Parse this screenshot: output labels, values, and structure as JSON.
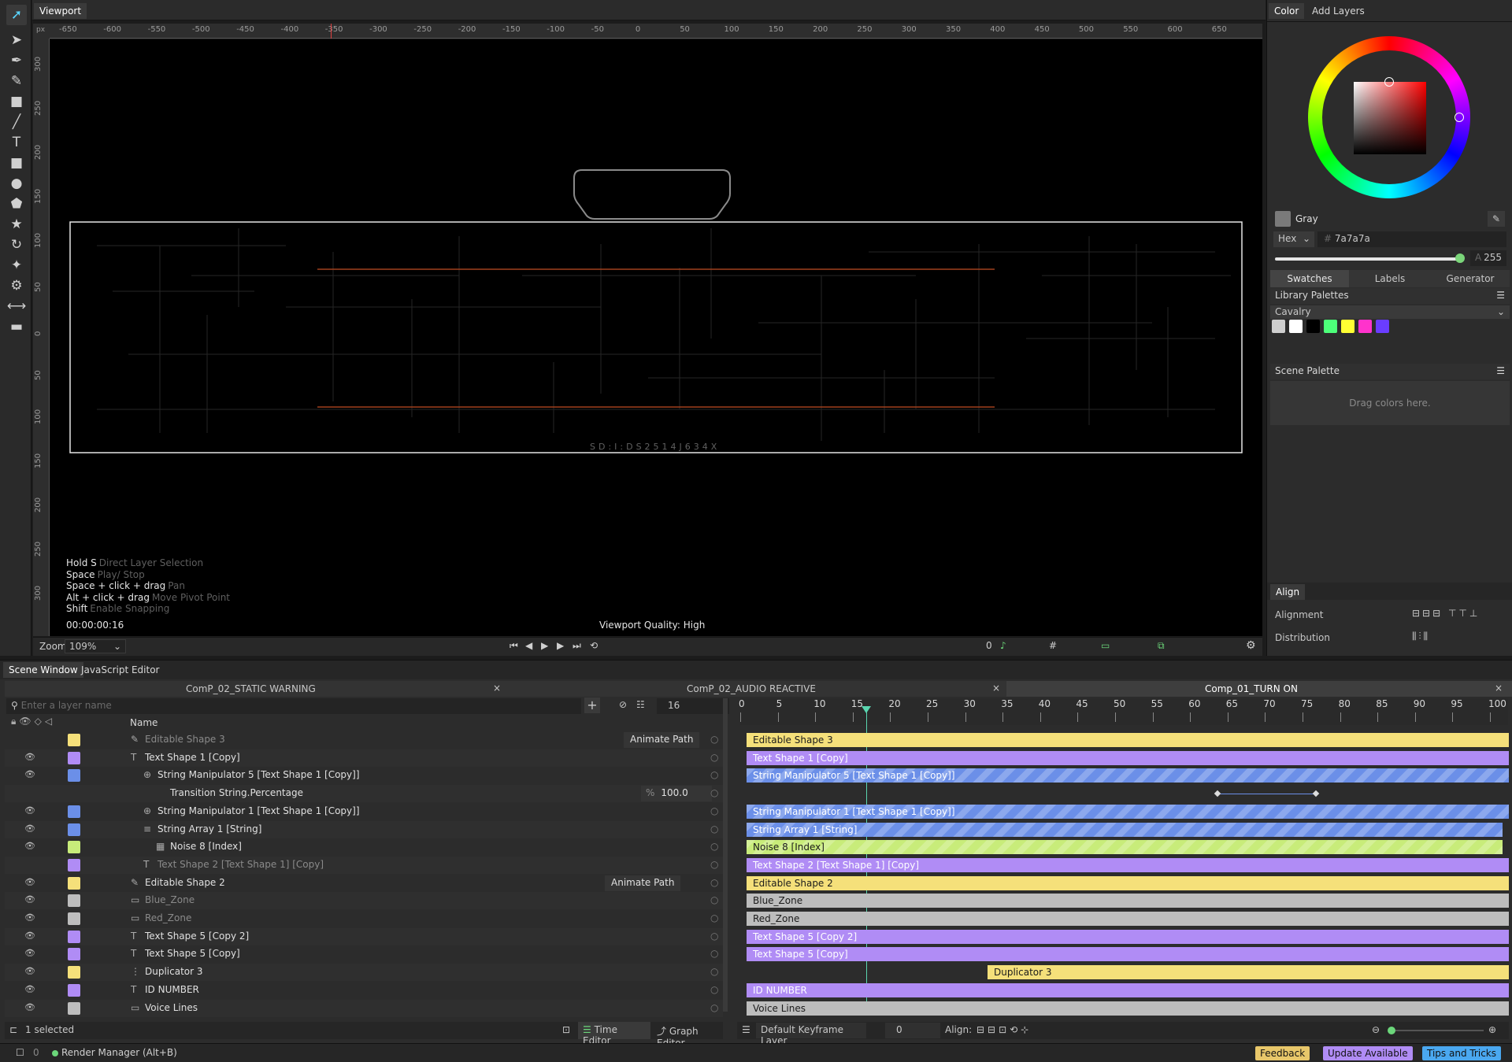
{
  "viewport": {
    "tab": "Viewport",
    "unit": "px",
    "ruler_h": [
      "-650",
      "-600",
      "-550",
      "-500",
      "-450",
      "-400",
      "-350",
      "-300",
      "-250",
      "-200",
      "-150",
      "-100",
      "-50",
      "0",
      "50",
      "100",
      "150",
      "200",
      "250",
      "300",
      "350",
      "400",
      "450",
      "500",
      "550",
      "600",
      "650"
    ],
    "ruler_v": [
      "300",
      "250",
      "200",
      "150",
      "100",
      "50",
      "0",
      "50",
      "100",
      "150",
      "200",
      "250",
      "300"
    ],
    "canvas_caption": "SD:I:DS2514J634X",
    "hints": [
      {
        "key": "Hold S",
        "desc": "Direct Layer Selection"
      },
      {
        "key": "Space",
        "desc": "Play/ Stop"
      },
      {
        "key": "Space + click + drag",
        "desc": "Pan"
      },
      {
        "key": "Alt + click + drag",
        "desc": "Move Pivot Point"
      },
      {
        "key": "Shift",
        "desc": "Enable Snapping"
      }
    ],
    "timecode": "00:00:00:16",
    "quality": "Viewport Quality: High",
    "zoom_label": "Zoom",
    "zoom_value": "109%",
    "frame_value": "0"
  },
  "color": {
    "tabs": [
      "Color",
      "Add Layers"
    ],
    "name": "Gray",
    "hex_label": "Hex",
    "hex": "7a7a7a",
    "alpha_label": "A",
    "alpha": "255",
    "subtabs": [
      "Swatches",
      "Labels",
      "Generator"
    ],
    "library_title": "Library Palettes",
    "palette_name": "Cavalry",
    "swatches": [
      "#cfcfcf",
      "#ffffff",
      "#000000",
      "#4dff7a",
      "#ffff33",
      "#ff33cc",
      "#6a3dff"
    ],
    "scene_palette": "Scene Palette",
    "drag_hint": "Drag colors here."
  },
  "align": {
    "title": "Align",
    "alignment": "Alignment",
    "distribution": "Distribution"
  },
  "scene": {
    "tabs": [
      "Scene Window",
      "JavaScript Editor"
    ],
    "comps": [
      "ComP_02_STATIC WARNING",
      "ComP_02_AUDIO REACTIVE",
      "Comp_01_TURN ON"
    ],
    "search_placeholder": "Enter a layer name",
    "frame": "16",
    "name_header": "Name",
    "animate_path": "Animate Path",
    "transition_value": "100.0",
    "pct": "%",
    "layers": [
      {
        "name": "Editable Shape 3",
        "color": "#f5e07a",
        "dim": true
      },
      {
        "name": "Text Shape 1 [Copy]",
        "color": "#b08cf5",
        "dim": false
      },
      {
        "name": "String Manipulator 5 [Text Shape 1 [Copy]]",
        "color": "#6b8fe8",
        "dim": false
      },
      {
        "name": "Transition String.Percentage",
        "color": "",
        "dim": false
      },
      {
        "name": "String Manipulator 1 [Text Shape 1 [Copy]]",
        "color": "#6b8fe8",
        "dim": false
      },
      {
        "name": "String Array 1 [String]",
        "color": "#6b8fe8",
        "dim": false
      },
      {
        "name": "Noise 8 [Index]",
        "color": "#c8ec7a",
        "dim": false
      },
      {
        "name": "Text Shape 2 [Text Shape 1] [Copy]",
        "color": "#b08cf5",
        "dim": true
      },
      {
        "name": "Editable Shape 2",
        "color": "#f5e07a",
        "dim": false
      },
      {
        "name": "Blue_Zone",
        "color": "#bdbdbd",
        "dim": true
      },
      {
        "name": "Red_Zone",
        "color": "#bdbdbd",
        "dim": true
      },
      {
        "name": "Text Shape 5 [Copy 2]",
        "color": "#b08cf5",
        "dim": false
      },
      {
        "name": "Text Shape 5 [Copy]",
        "color": "#b08cf5",
        "dim": false
      },
      {
        "name": "Duplicator 3",
        "color": "#f5e07a",
        "dim": false
      },
      {
        "name": "ID NUMBER",
        "color": "#b08cf5",
        "dim": false
      },
      {
        "name": "Voice Lines",
        "color": "#bdbdbd",
        "dim": false
      }
    ],
    "ticks": [
      "0",
      "5",
      "10",
      "15",
      "20",
      "25",
      "30",
      "35",
      "40",
      "45",
      "50",
      "55",
      "60",
      "65",
      "70",
      "75",
      "80",
      "85",
      "90",
      "95",
      "100"
    ],
    "bars": [
      "Editable Shape 3",
      "Text Shape 1 [Copy]",
      "String Manipulator 5 [Text Shape 1 [Copy]]",
      "",
      "String Manipulator 1 [Text Shape 1 [Copy]]",
      "String Array 1 [String]",
      "Noise 8 [Index]",
      "Text Shape 2 [Text Shape 1] [Copy]",
      "Editable Shape 2",
      "Blue_Zone",
      "Red_Zone",
      "Text Shape 5 [Copy 2]",
      "Text Shape 5 [Copy]",
      "Duplicator 3",
      "ID NUMBER",
      "Voice Lines"
    ],
    "selected": "1 selected",
    "time_editor": "Time Editor",
    "graph_editor": "Graph Editor",
    "keyframe_layer": "Default Keyframe Layer",
    "kf_value": "0",
    "align_label": "Align:"
  },
  "status": {
    "render": "Render Manager (Alt+B)",
    "feedback": "Feedback",
    "update": "Update Available",
    "tips": "Tips and Tricks"
  }
}
